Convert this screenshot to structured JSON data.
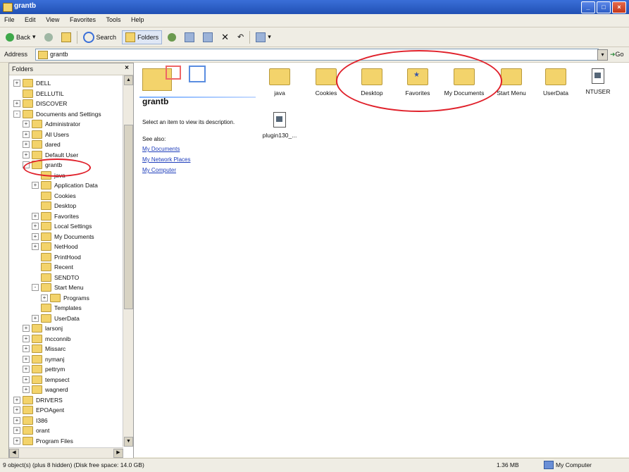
{
  "window": {
    "title": "grantb"
  },
  "menu": [
    "File",
    "Edit",
    "View",
    "Favorites",
    "Tools",
    "Help"
  ],
  "toolbar": {
    "back": "Back",
    "search": "Search",
    "folders": "Folders"
  },
  "address": {
    "label": "Address",
    "value": "grantb",
    "go": "Go"
  },
  "folders_pane": {
    "title": "Folders",
    "items": [
      {
        "label": "DELL",
        "expand": "+",
        "indent": 0
      },
      {
        "label": "DELLUTIL",
        "expand": "",
        "indent": 0
      },
      {
        "label": "DISCOVER",
        "expand": "+",
        "indent": 0
      },
      {
        "label": "Documents and Settings",
        "expand": "-",
        "indent": 0
      },
      {
        "label": "Administrator",
        "expand": "+",
        "indent": 1
      },
      {
        "label": "All Users",
        "expand": "+",
        "indent": 1
      },
      {
        "label": "dared",
        "expand": "+",
        "indent": 1
      },
      {
        "label": "Default User",
        "expand": "+",
        "indent": 1
      },
      {
        "label": "grantb",
        "expand": "-",
        "indent": 1
      },
      {
        "label": "java",
        "expand": "",
        "indent": 2
      },
      {
        "label": "Application Data",
        "expand": "+",
        "indent": 2
      },
      {
        "label": "Cookies",
        "expand": "",
        "indent": 2
      },
      {
        "label": "Desktop",
        "expand": "",
        "indent": 2
      },
      {
        "label": "Favorites",
        "expand": "+",
        "indent": 2
      },
      {
        "label": "Local Settings",
        "expand": "+",
        "indent": 2
      },
      {
        "label": "My Documents",
        "expand": "+",
        "indent": 2
      },
      {
        "label": "NetHood",
        "expand": "+",
        "indent": 2
      },
      {
        "label": "PrintHood",
        "expand": "",
        "indent": 2
      },
      {
        "label": "Recent",
        "expand": "",
        "indent": 2
      },
      {
        "label": "SENDTO",
        "expand": "",
        "indent": 2
      },
      {
        "label": "Start Menu",
        "expand": "-",
        "indent": 2
      },
      {
        "label": "Programs",
        "expand": "+",
        "indent": 3
      },
      {
        "label": "Templates",
        "expand": "",
        "indent": 2
      },
      {
        "label": "UserData",
        "expand": "+",
        "indent": 2
      },
      {
        "label": "larsonj",
        "expand": "+",
        "indent": 1
      },
      {
        "label": "mcconnib",
        "expand": "+",
        "indent": 1
      },
      {
        "label": "Missarc",
        "expand": "+",
        "indent": 1
      },
      {
        "label": "nymanj",
        "expand": "+",
        "indent": 1
      },
      {
        "label": "pettrym",
        "expand": "+",
        "indent": 1
      },
      {
        "label": "tempsect",
        "expand": "+",
        "indent": 1
      },
      {
        "label": "wagnerd",
        "expand": "+",
        "indent": 1
      },
      {
        "label": "DRIVERS",
        "expand": "+",
        "indent": 0
      },
      {
        "label": "EPOAgent",
        "expand": "+",
        "indent": 0
      },
      {
        "label": "I386",
        "expand": "+",
        "indent": 0
      },
      {
        "label": "orant",
        "expand": "+",
        "indent": 0
      },
      {
        "label": "Program Files",
        "expand": "+",
        "indent": 0
      }
    ]
  },
  "main": {
    "folder_title": "grantb",
    "description": "Select an item to view its description.",
    "see_also": "See also:",
    "links": [
      "My Documents",
      "My Network Places",
      "My Computer"
    ],
    "items": [
      {
        "label": "java",
        "kind": "folder"
      },
      {
        "label": "Cookies",
        "kind": "folder"
      },
      {
        "label": "Desktop",
        "kind": "folder"
      },
      {
        "label": "Favorites",
        "kind": "favorites"
      },
      {
        "label": "My Documents",
        "kind": "folder"
      },
      {
        "label": "Start Menu",
        "kind": "folder"
      },
      {
        "label": "UserData",
        "kind": "folder"
      },
      {
        "label": "NTUSER",
        "kind": "doc"
      },
      {
        "label": "plugin130_...",
        "kind": "doc"
      }
    ]
  },
  "status": {
    "objects": "9 object(s) (plus 8 hidden) (Disk free space: 14.0 GB)",
    "size": "1.36 MB",
    "zone": "My Computer"
  },
  "annotation_color": "#e0202a"
}
